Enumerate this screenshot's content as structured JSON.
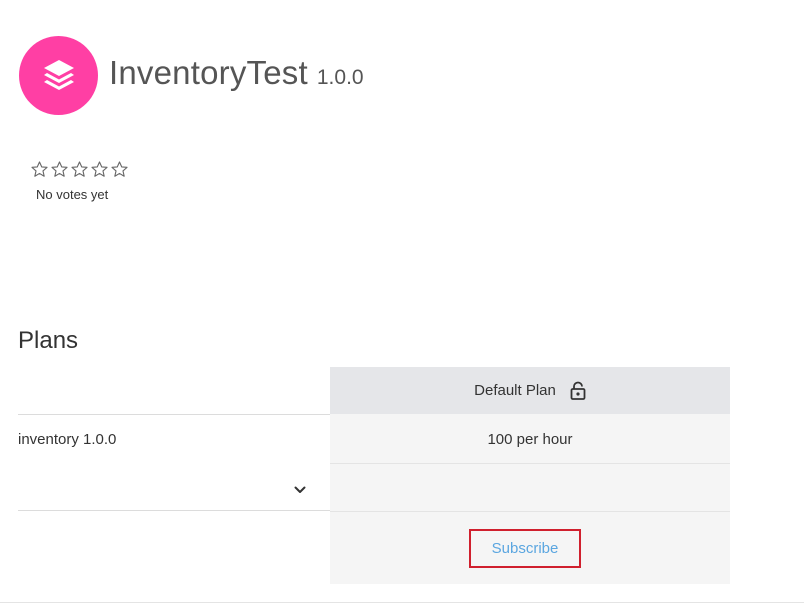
{
  "app": {
    "title": "InventoryTest",
    "version": "1.0.0",
    "logo_icon": "layers-icon",
    "logo_color": "#ff3fa4"
  },
  "rating": {
    "stars_total": 5,
    "stars_filled": 0,
    "votes_text": "No votes yet"
  },
  "plans": {
    "heading": "Plans",
    "columns": [
      {
        "name": "Default Plan",
        "icon": "lock-icon"
      }
    ],
    "rows": [
      {
        "api": "inventory 1.0.0",
        "values": [
          "100 per hour"
        ]
      }
    ],
    "subscribe_label": "Subscribe"
  },
  "colors": {
    "accent_link": "#5ba6e0",
    "highlight_border": "#d0202e",
    "header_bg": "#e5e6e9",
    "column_bg": "#f5f5f5"
  }
}
